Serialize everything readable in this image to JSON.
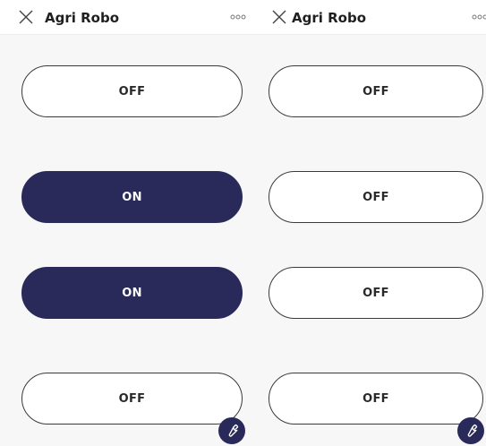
{
  "screens": [
    {
      "title": "Agri Robo",
      "switches": [
        {
          "label": "OFF",
          "state": "off"
        },
        {
          "label": "ON",
          "state": "on"
        },
        {
          "label": "ON",
          "state": "on"
        },
        {
          "label": "OFF",
          "state": "off"
        }
      ]
    },
    {
      "title": "Agri Robo",
      "switches": [
        {
          "label": "OFF",
          "state": "off"
        },
        {
          "label": "OFF",
          "state": "off"
        },
        {
          "label": "OFF",
          "state": "off"
        },
        {
          "label": "OFF",
          "state": "off"
        }
      ]
    }
  ],
  "icons": {
    "close": "close-icon",
    "more": "more-dots-icon",
    "settings": "wrench-icon"
  },
  "colors": {
    "on_background": "#2a2a5a",
    "off_background": "#ffffff",
    "page_background": "#f7f7f7"
  }
}
